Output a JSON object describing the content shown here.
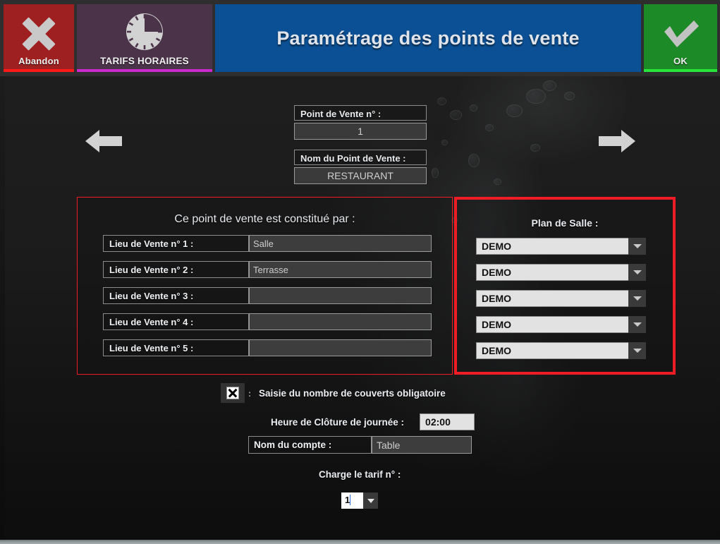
{
  "window": {
    "title": "Paramétrage des points de vente"
  },
  "toolbar": {
    "abandon_label": "Abandon",
    "tarifs_label": "TARIFS HORAIRES",
    "ok_label": "OK",
    "colors": {
      "abandon_bg": "#9e2020",
      "abandon_underline": "#ff1a1a",
      "tarifs_bg": "#4b3349",
      "tarifs_underline": "#cc29cc",
      "title_bg": "#0b5094",
      "ok_bg": "#1d8a28",
      "ok_underline": "#27e53a"
    }
  },
  "nav": {
    "prev_label": "Précédent",
    "next_label": "Suivant"
  },
  "header_fields": {
    "pdv_number_label": "Point de Vente n° :",
    "pdv_number_value": "1",
    "pdv_name_label": "Nom du Point de Vente :",
    "pdv_name_value": "RESTAURANT"
  },
  "left_panel": {
    "title": "Ce point de vente est constitué par :",
    "border_color": "#ee1c24",
    "rows": [
      {
        "label": "Lieu de Vente n° 1 :",
        "value": "Salle"
      },
      {
        "label": "Lieu de Vente n° 2 :",
        "value": "Terrasse"
      },
      {
        "label": "Lieu de Vente n° 3 :",
        "value": ""
      },
      {
        "label": "Lieu de Vente n° 4 :",
        "value": ""
      },
      {
        "label": "Lieu de Vente n° 5 :",
        "value": ""
      }
    ]
  },
  "right_panel": {
    "title": "Plan de Salle :",
    "border_color": "#ee1c24",
    "selects": [
      {
        "value": "DEMO"
      },
      {
        "value": "DEMO"
      },
      {
        "value": "DEMO"
      },
      {
        "value": "DEMO"
      },
      {
        "value": "DEMO"
      }
    ]
  },
  "bottom": {
    "checkbox_checked": "true",
    "checkbox_separator": ":",
    "checkbox_label": "Saisie du nombre de couverts obligatoire",
    "closing_hour_label": "Heure de Clôture de journée :",
    "closing_hour_value": "02:00",
    "account_name_label": "Nom  du compte :",
    "account_name_value": "Table",
    "tarif_label": "Charge le tarif n° :",
    "tarif_value": "1"
  }
}
